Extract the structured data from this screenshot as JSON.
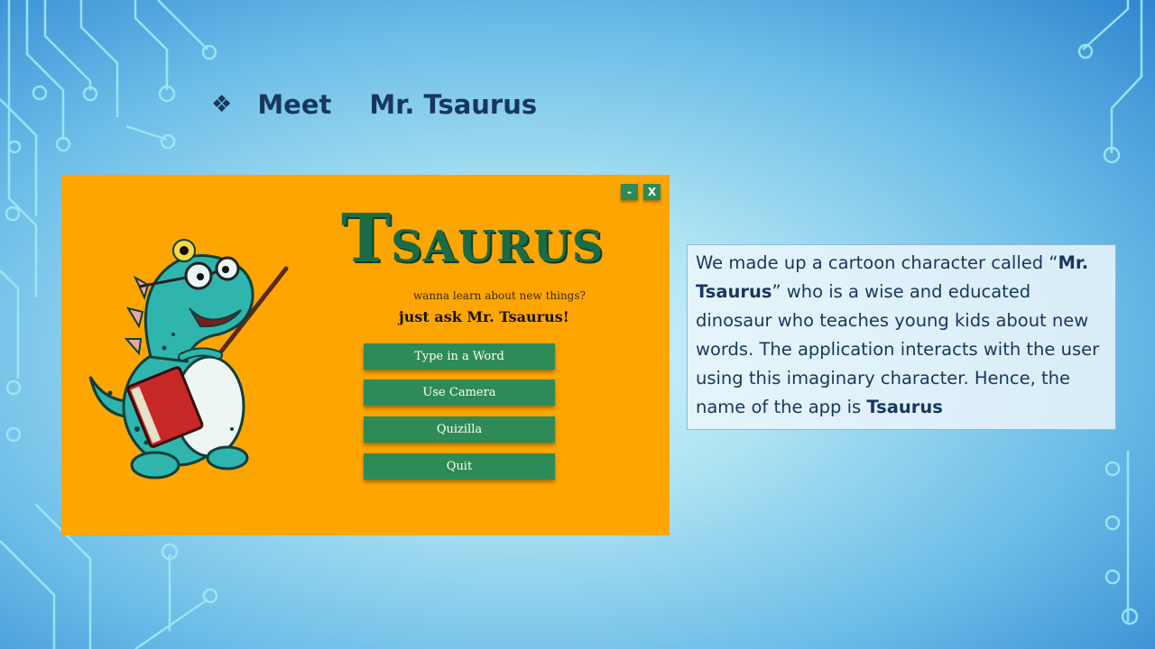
{
  "slide": {
    "bullet_icon": "diamond-bullet-icon",
    "title_part1": "Meet",
    "title_part2": "Mr. Tsaurus"
  },
  "app": {
    "window_controls": {
      "minimize": "-",
      "close": "X"
    },
    "logo_initial": "T",
    "logo_rest": "SAURUS",
    "tagline": "wanna learn about new things?",
    "ask": "just ask Mr. Tsaurus!",
    "buttons": [
      "Type in a Word",
      "Use Camera",
      "Quizilla",
      "Quit"
    ],
    "colors": {
      "background": "#ffa500",
      "button": "#2e8b57",
      "logo": "#1c6b47"
    }
  },
  "description": {
    "p1": "We made up a cartoon character called “",
    "name": "Mr. Tsaurus",
    "p2": "” who is a wise and educated dinosaur who teaches young kids about new words. The application interacts with the user using this imaginary character. Hence, the name of the app is ",
    "app_name": "Tsaurus"
  }
}
